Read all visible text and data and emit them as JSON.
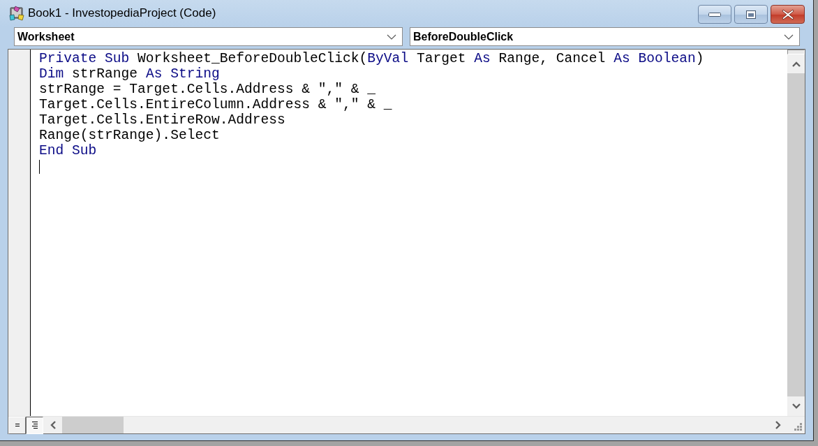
{
  "window": {
    "title": "Book1 - InvestopediaProject (Code)"
  },
  "object_dropdown": {
    "value": "Worksheet"
  },
  "procedure_dropdown": {
    "value": "BeforeDoubleClick"
  },
  "code_lines": [
    {
      "tokens": [
        {
          "text": "Private Sub",
          "kind": "keyword"
        },
        {
          "text": " Worksheet_BeforeDoubleClick(",
          "kind": "plain"
        },
        {
          "text": "ByVal",
          "kind": "keyword"
        },
        {
          "text": " Target ",
          "kind": "plain"
        },
        {
          "text": "As",
          "kind": "keyword"
        },
        {
          "text": " Range, Cancel ",
          "kind": "plain"
        },
        {
          "text": "As Boolean",
          "kind": "keyword"
        },
        {
          "text": ")",
          "kind": "plain"
        }
      ],
      "cursor": false
    },
    {
      "tokens": [
        {
          "text": "Dim",
          "kind": "keyword"
        },
        {
          "text": " strRange ",
          "kind": "plain"
        },
        {
          "text": "As String",
          "kind": "keyword"
        }
      ],
      "cursor": false
    },
    {
      "tokens": [
        {
          "text": "strRange = Target.Cells.Address & \",\" & _",
          "kind": "plain"
        }
      ],
      "cursor": false
    },
    {
      "tokens": [
        {
          "text": "Target.Cells.EntireColumn.Address & \",\" & _",
          "kind": "plain"
        }
      ],
      "cursor": false
    },
    {
      "tokens": [
        {
          "text": "Target.Cells.EntireRow.Address",
          "kind": "plain"
        }
      ],
      "cursor": false
    },
    {
      "tokens": [
        {
          "text": "Range(strRange).Select",
          "kind": "plain"
        }
      ],
      "cursor": false
    },
    {
      "tokens": [
        {
          "text": "End Sub",
          "kind": "keyword"
        }
      ],
      "cursor": false
    },
    {
      "cursor": true
    }
  ],
  "view_buttons": [
    {
      "kind": "procedure",
      "selected": false
    },
    {
      "kind": "module",
      "selected": true
    }
  ]
}
